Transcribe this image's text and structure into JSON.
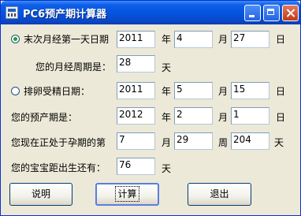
{
  "window": {
    "title": "PC6预产期计算器"
  },
  "rows": {
    "last_period": {
      "label": "末次月经第一天日期",
      "year": "2011",
      "month": "4",
      "day": "27",
      "unit_year": "年",
      "unit_month": "月",
      "unit_day": "日",
      "selected": true
    },
    "cycle": {
      "label": "您的月经周期是：",
      "value": "28",
      "unit": "天"
    },
    "ovulation": {
      "label": "排卵受精日期：",
      "year": "2011",
      "month": "5",
      "day": "15",
      "unit_year": "年",
      "unit_month": "月",
      "unit_day": "日",
      "selected": false
    },
    "due_date": {
      "label": "您的预产期是：",
      "year": "2012",
      "month": "2",
      "day": "1",
      "unit_year": "年",
      "unit_month": "月",
      "unit_day": "日"
    },
    "pregnancy": {
      "label": "您现在正处于孕期的第",
      "month": "7",
      "week": "29",
      "day": "204",
      "unit_month": "月",
      "unit_week": "周",
      "unit_day": "天"
    },
    "countdown": {
      "label": "您的宝宝距出生还有：",
      "value": "76",
      "unit": "天"
    }
  },
  "buttons": {
    "help": "说明",
    "calculate": "计算",
    "exit": "退出"
  }
}
